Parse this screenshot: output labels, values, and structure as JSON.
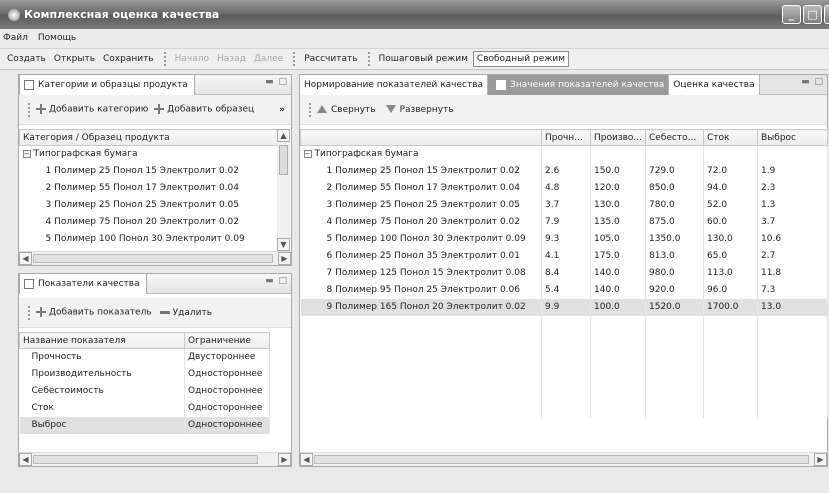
{
  "window": {
    "title": "Комплексная оценка качества"
  },
  "menu": [
    "Файл",
    "Помощь"
  ],
  "toolbar": {
    "create": "Создать",
    "open": "Открыть",
    "save": "Сохранить",
    "start": "Начало",
    "back": "Назад",
    "next": "Далее",
    "calculate": "Рассчитать",
    "step_mode": "Пошаговый режим",
    "free_mode": "Свободный режим"
  },
  "categories_panel": {
    "title": "Категории и образцы продукта",
    "add_category": "Добавить категорию",
    "add_sample": "Добавить образец",
    "more": "»",
    "column": "Категория / Образец продукта",
    "group": "Типографская бумага",
    "items": [
      "1 Полимер 25 Понол 15 Электролит 0.02",
      "2 Полимер 55 Понол 17 Электролит 0.04",
      "3 Полимер 25 Понол 25 Электролит 0.05",
      "4 Полимер 75 Понол 20 Электролит 0.02",
      "5 Полимер 100 Понол 30 Электролит 0.09"
    ]
  },
  "indicators_panel": {
    "title": "Показатели качества",
    "add": "Добавить показатель",
    "delete": "Удалить",
    "columns": [
      "Название показателя",
      "Ограничение"
    ],
    "rows": [
      [
        "Прочность",
        "Двустороннее"
      ],
      [
        "Производительность",
        "Одностороннее"
      ],
      [
        "Себестоимость",
        "Одностороннее"
      ],
      [
        "Сток",
        "Одностороннее"
      ],
      [
        "Выброс",
        "Одностороннее"
      ]
    ]
  },
  "main_panel": {
    "tabs": [
      "Нормирование показателей качества",
      "Значения показателей качества",
      "Оценка качества"
    ],
    "collapse": "Свернуть",
    "expand": "Развернуть",
    "columns": [
      "Прочн...",
      "Произво...",
      "Себесто...",
      "Сток",
      "Выброс"
    ],
    "group": "Типографская бумага",
    "rows": [
      {
        "name": "1 Полимер 25 Понол 15 Электролит 0.02",
        "v": [
          "2.6",
          "150.0",
          "729.0",
          "72.0",
          "1.9"
        ]
      },
      {
        "name": "2 Полимер 55 Понол 17 Электролит 0.04",
        "v": [
          "4.8",
          "120.0",
          "850.0",
          "94.0",
          "2.3"
        ]
      },
      {
        "name": "3 Полимер 25 Понол 25 Электролит 0.05",
        "v": [
          "3.7",
          "130.0",
          "780.0",
          "52.0",
          "1.3"
        ]
      },
      {
        "name": "4 Полимер 75 Понол 20 Электролит 0.02",
        "v": [
          "7.9",
          "135.0",
          "875.0",
          "60.0",
          "3.7"
        ]
      },
      {
        "name": "5 Полимер 100 Понол 30 Электролит 0.09",
        "v": [
          "9.3",
          "105.0",
          "1350.0",
          "130.0",
          "10.6"
        ]
      },
      {
        "name": "6 Полимер 25 Понол 35 Электролит 0.01",
        "v": [
          "4.1",
          "175.0",
          "813.0",
          "65.0",
          "2.7"
        ]
      },
      {
        "name": "7 Полимер 125 Понол 15 Электролит 0.08",
        "v": [
          "8.4",
          "140.0",
          "980.0",
          "113.0",
          "11.8"
        ]
      },
      {
        "name": "8 Полимер 95 Понол 25 Электролит 0.06",
        "v": [
          "5.4",
          "140.0",
          "920.0",
          "96.0",
          "7.3"
        ]
      },
      {
        "name": "9 Полимер 165 Понол 20 Электролит 0.02",
        "v": [
          "9.9",
          "100.0",
          "1520.0",
          "1700.0",
          "13.0"
        ]
      }
    ]
  }
}
